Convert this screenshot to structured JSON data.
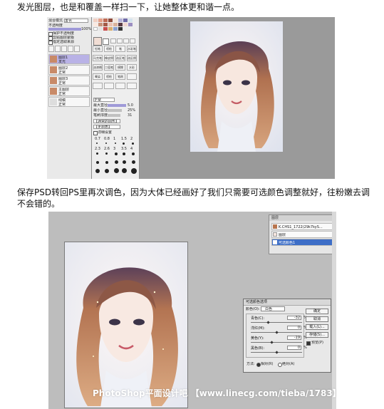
{
  "paragraphs": {
    "p1": "发光图层，也是和覆盖一样扫一下，让她整体更和谐一点。",
    "p2": "保存PSD转回PS里再次调色，因为大体已经画好了我们只需要可选颜色调整就好，往粉嫩去调不会错的。"
  },
  "sai": {
    "blend_label": "混合模式",
    "blend_value": "发光",
    "opacity_label": "不透明度",
    "opacity_value": "100%",
    "checks": [
      "保护不透明度",
      "剪贴图层蒙版",
      "指定选取来源"
    ],
    "layers": [
      {
        "name": "图层1",
        "mode": "发光"
      },
      {
        "name": "图层2",
        "mode": "正常"
      },
      {
        "name": "图层3",
        "mode": "正常"
      },
      {
        "name": "主图层",
        "mode": "正常"
      },
      {
        "name": "线稿",
        "mode": "正常"
      }
    ],
    "tools": [
      "铅笔",
      "喷枪",
      "笔",
      "水彩笔",
      "马克笔",
      "橡皮擦",
      "选区笔",
      "选区擦",
      "油漆桶",
      "二值笔",
      "模糊",
      "水彩",
      "晕染",
      "喷枪",
      "笔刷"
    ],
    "mode_label": "正常",
    "size_label": "最大直径",
    "size_value": "5.0",
    "min_label": "最小直径",
    "min_value": "25%",
    "density_label": "笔刷浓度",
    "density_value": "31",
    "shape_label": "【通常的圆形】",
    "texture_label": "【无材质】",
    "detail_label": "详细设置",
    "brush_sizes": [
      "0.7",
      "0.8",
      "1",
      "1.5",
      "2",
      "2.3",
      "2.6",
      "3",
      "3.5",
      "4"
    ]
  },
  "ps": {
    "layers_title": "图层",
    "layers": [
      {
        "name": "K.CHS1_1722(29k7kyS...",
        "selected": false
      },
      {
        "name": "图层",
        "selected": false
      },
      {
        "name": "可选颜色1",
        "selected": true
      }
    ],
    "dialog": {
      "title": "可选颜色选项",
      "colors_label": "颜色(O):",
      "colors_value": "白色",
      "rows": [
        {
          "label": "青色(C):",
          "value": "-32"
        },
        {
          "label": "洋红(M):",
          "value": "0"
        },
        {
          "label": "黄色(Y):",
          "value": "-19"
        },
        {
          "label": "黑色(B):",
          "value": "0"
        }
      ],
      "pct": "%",
      "method_label": "方法:",
      "relative": "相对(R)",
      "absolute": "绝对(A)",
      "btn_ok": "确定",
      "btn_cancel": "取消",
      "btn_load": "载入(L)...",
      "btn_save": "存储(S)...",
      "preview": "预览(P)"
    },
    "watermark": "PhotoShop平面设计吧 【www.linecg.com/tieba/1783】"
  },
  "colors": {
    "sai_selected": "#b9b2e6",
    "ps_selected": "#3d6ec7",
    "hair": "#b8764f",
    "skin": "#f7e7df"
  }
}
